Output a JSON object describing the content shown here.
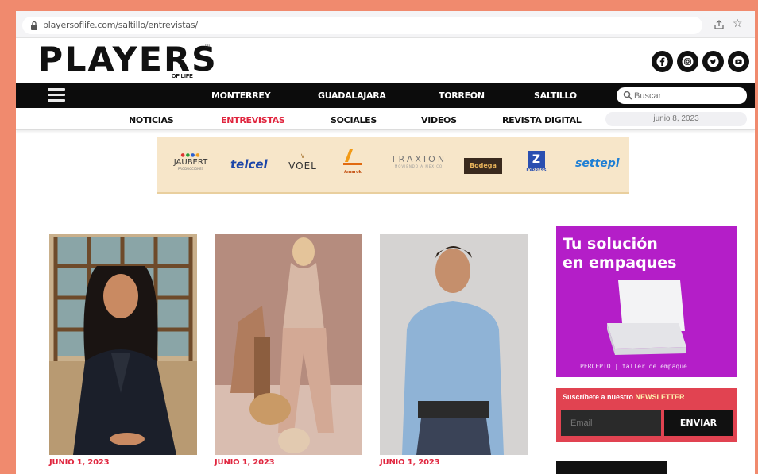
{
  "browser": {
    "url": "playersoflife.com/saltillo/entrevistas/"
  },
  "header": {
    "logo": "PLAYERS",
    "logo_reg": "®",
    "logo_sub": "OF LIFE",
    "social_icons": [
      "facebook-icon",
      "instagram-icon",
      "twitter-icon",
      "youtube-icon"
    ]
  },
  "main_nav": {
    "items": [
      "MONTERREY",
      "GUADALAJARA",
      "TORREÓN",
      "SALTILLO"
    ],
    "search_placeholder": "Buscar"
  },
  "sub_nav": {
    "items": [
      "NOTICIAS",
      "ENTREVISTAS",
      "SOCIALES",
      "VIDEOS",
      "REVISTA DIGITAL"
    ],
    "active": "ENTREVISTAS",
    "date": "junio 8, 2023"
  },
  "sponsors": {
    "items": [
      "JAUBERT",
      "telcel",
      "VOEL",
      "Amarok",
      "TRAXION",
      "Bodega",
      "EXPRESS",
      "settepi"
    ],
    "jaubert_sub": "PRODUCCIONES",
    "traxion_sub": "MOVIENDO A MEXICO",
    "express_sub": "EXPRESS",
    "bodega_label": "Bodega"
  },
  "articles": [
    {
      "date": "JUNIO 1, 2023"
    },
    {
      "date": "JUNIO 1, 2023"
    },
    {
      "date": "JUNIO 1, 2023"
    }
  ],
  "sidebar_ad": {
    "title": "Tu solución\nen empaques",
    "brand": "PERCEPTO | taller de empaque"
  },
  "newsletter": {
    "title_prefix": "Suscríbete a nuestro",
    "title_highlight": "NEWSLETTER",
    "email_placeholder": "Email",
    "button": "ENVIAR"
  },
  "colors": {
    "accent_red": "#e0253e",
    "ad_purple": "#b41ec8",
    "newsletter_red": "#e14351",
    "page_bg": "#f08a6e"
  }
}
